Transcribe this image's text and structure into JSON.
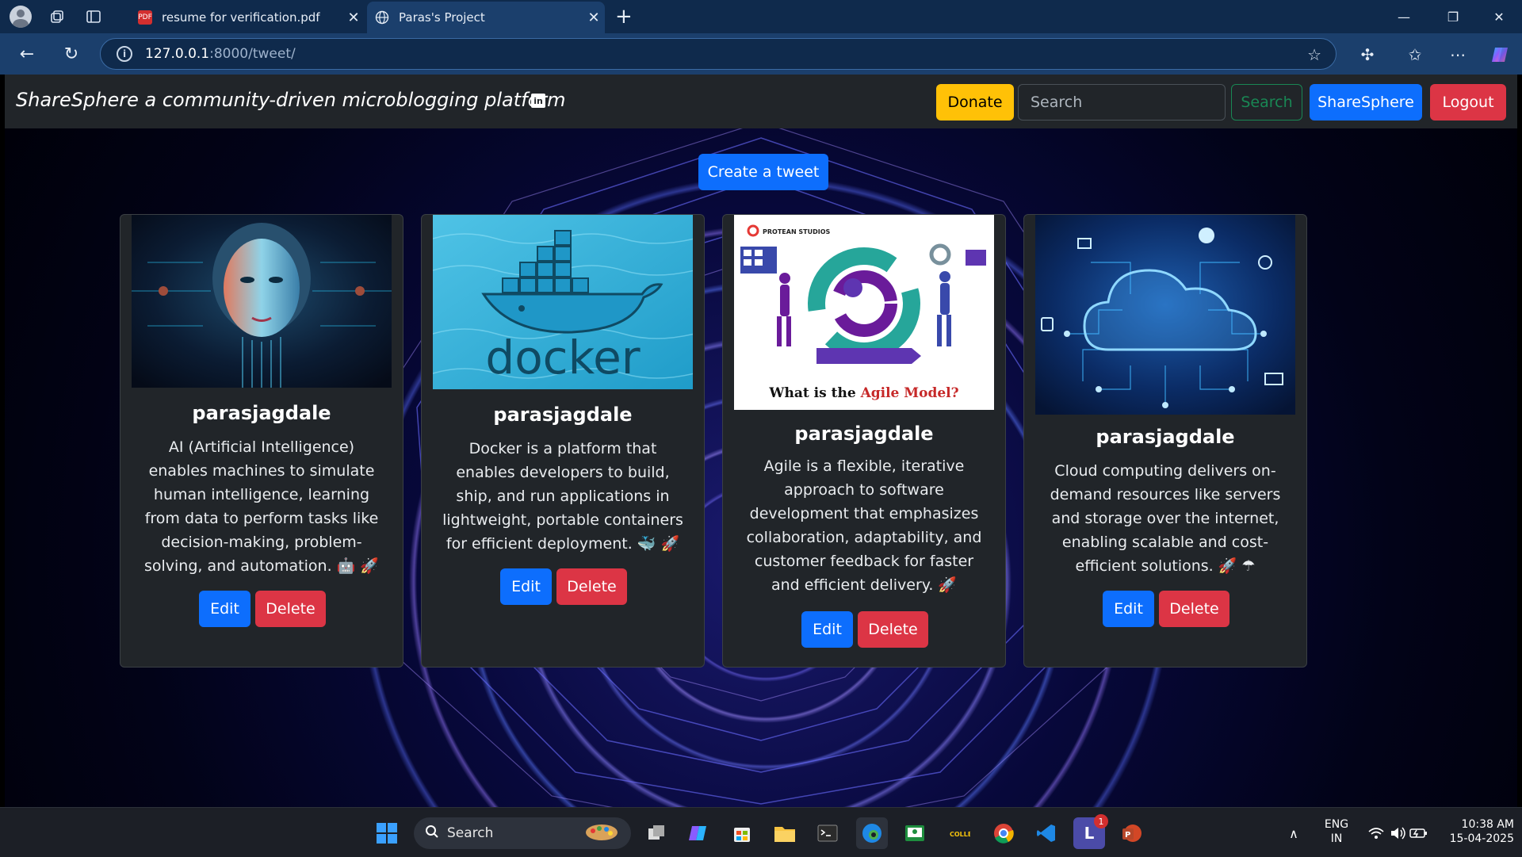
{
  "browser": {
    "tabs": [
      {
        "title": "resume for verification.pdf",
        "active": false
      },
      {
        "title": "Paras's Project",
        "active": true
      }
    ],
    "url_host": "127.0.0.1",
    "url_rest": ":8000/tweet/"
  },
  "navbar": {
    "brand": "ShareSphere a community-driven microblogging platform",
    "linkedin_icon": "linkedin-icon",
    "donate_label": "Donate",
    "search_placeholder": "Search",
    "search_label": "Search",
    "sharesphere_label": "ShareSphere",
    "logout_label": "Logout"
  },
  "create_label": "Create a tweet",
  "cards": [
    {
      "user": "parasjagdale",
      "text": "AI (Artificial Intelligence) enables machines to simulate human intelligence, learning from data to perform tasks like decision-making, problem-solving, and automation. 🤖 🚀",
      "edit": "Edit",
      "delete": "Delete"
    },
    {
      "user": "parasjagdale",
      "text": "Docker is a platform that enables developers to build, ship, and run applications in lightweight, portable containers for efficient deployment. 🐳 🚀",
      "edit": "Edit",
      "delete": "Delete",
      "image_text": "docker"
    },
    {
      "user": "parasjagdale",
      "text": "Agile is a flexible, iterative approach to software development that emphasizes collaboration, adaptability, and customer feedback for faster and efficient delivery. 🚀",
      "edit": "Edit",
      "delete": "Delete",
      "image_brand": "PROTEAN STUDIOS",
      "image_caption_1": "What is the",
      "image_caption_2": "Agile Model?"
    },
    {
      "user": "parasjagdale",
      "text": "Cloud computing delivers on-demand resources like servers and storage over the internet, enabling scalable and cost-efficient solutions. 🚀 ☂",
      "edit": "Edit",
      "delete": "Delete"
    }
  ],
  "taskbar": {
    "search_label": "Search",
    "lang_1": "ENG",
    "lang_2": "IN",
    "time": "10:38 AM",
    "date": "15-04-2025",
    "badge": "1"
  },
  "colors": {
    "primary": "#0d6efd",
    "danger": "#dc3545",
    "warning": "#ffc107",
    "success": "#198754",
    "dark": "#212529"
  }
}
